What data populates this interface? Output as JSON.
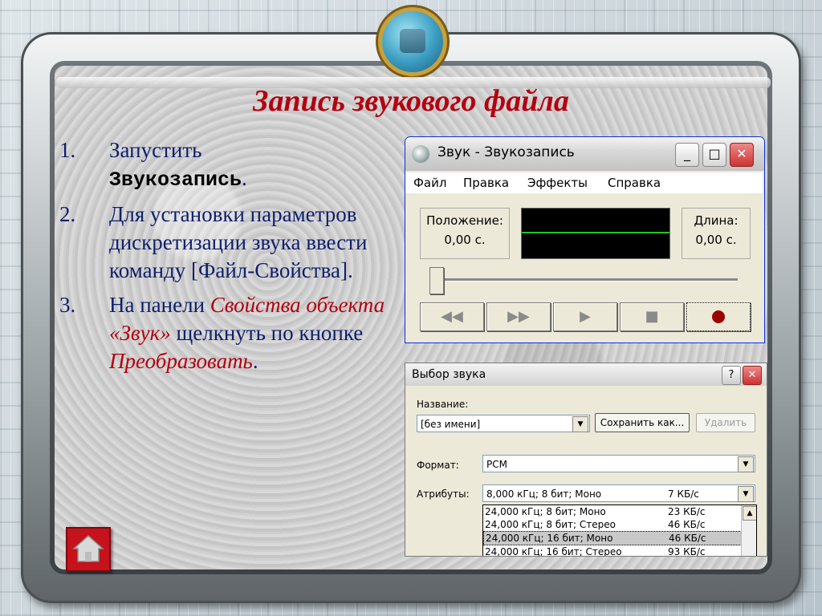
{
  "slide": {
    "title": "Запись звукового файла",
    "steps": [
      {
        "num": "1.",
        "pre": "Запустить ",
        "mono": "Звукозапись",
        "post": "."
      },
      {
        "num": "2.",
        "text": "Для установки параметров дискретизации звука ввести команду [Файл-Свойства]."
      },
      {
        "num": "3.",
        "pre": "На панели ",
        "red1": "Свойства объекта «Звук»",
        "mid": " щелкнуть по кнопке ",
        "red2": "Преобразовать",
        "post": "."
      }
    ],
    "home_icon": "home-icon"
  },
  "recorder": {
    "title": "Звук - Звукозапись",
    "menu": [
      "Файл",
      "Правка",
      "Эффекты",
      "Справка"
    ],
    "position_label": "Положение:",
    "position_value": "0,00 с.",
    "length_label": "Длина:",
    "length_value": "0,00 с.",
    "buttons": [
      "rewind-icon",
      "fast-forward-icon",
      "play-icon",
      "stop-icon",
      "record-icon"
    ]
  },
  "sound_dialog": {
    "title": "Выбор звука",
    "help": "?",
    "name_label": "Название:",
    "name_value": "[без имени]",
    "save_as": "Сохранить как...",
    "delete": "Удалить",
    "format_label": "Формат:",
    "format_value": "PCM",
    "attrs_label": "Атрибуты:",
    "attrs_value": "8,000 кГц; 8 бит; Моно",
    "attrs_rate": "7 КБ/с",
    "options": [
      {
        "text": "24,000 кГц; 8 бит; Моно",
        "rate": "23 КБ/с"
      },
      {
        "text": "24,000 кГц; 8 бит; Стерео",
        "rate": "46 КБ/с"
      },
      {
        "text": "24,000 кГц; 16 бит; Моно",
        "rate": "46 КБ/с",
        "selected": true
      },
      {
        "text": "24,000 кГц; 16 бит; Стерео",
        "rate": "93 КБ/с"
      }
    ]
  }
}
